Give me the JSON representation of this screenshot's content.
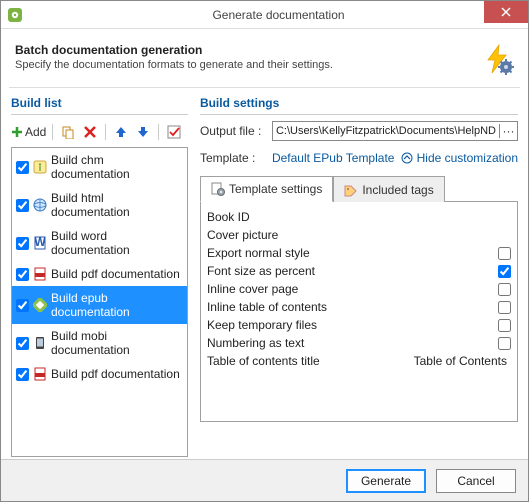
{
  "window": {
    "title": "Generate documentation",
    "close": "×"
  },
  "header": {
    "title": "Batch documentation generation",
    "subtitle": "Specify the documentation formats to generate and their settings."
  },
  "build_list": {
    "title": "Build list",
    "add_label": "Add",
    "items": [
      {
        "label": "Build chm documentation"
      },
      {
        "label": "Build html documentation"
      },
      {
        "label": "Build word documentation"
      },
      {
        "label": "Build pdf documentation"
      },
      {
        "label": "Build epub documentation"
      },
      {
        "label": "Build mobi documentation"
      },
      {
        "label": "Build pdf documentation"
      }
    ]
  },
  "build_settings": {
    "title": "Build settings",
    "output_label": "Output file :",
    "output_value": "C:\\Users\\KellyFitzpatrick\\Documents\\HelpND",
    "output_more": "···",
    "template_label": "Template :",
    "template_value": "Default EPub Template",
    "hide_customization": "Hide customization",
    "tabs": {
      "template_settings": "Template settings",
      "included_tags": "Included tags"
    },
    "settings": [
      {
        "label": "Book ID",
        "type": "text",
        "value": ""
      },
      {
        "label": "Cover picture",
        "type": "text",
        "value": ""
      },
      {
        "label": "Export normal style",
        "type": "check",
        "checked": false
      },
      {
        "label": "Font size as percent",
        "type": "check",
        "checked": true
      },
      {
        "label": "Inline cover page",
        "type": "check",
        "checked": false
      },
      {
        "label": "Inline table of contents",
        "type": "check",
        "checked": false
      },
      {
        "label": "Keep temporary files",
        "type": "check",
        "checked": false
      },
      {
        "label": "Numbering as text",
        "type": "check",
        "checked": false
      },
      {
        "label": "Table of contents title",
        "type": "text",
        "value": "Table of Contents"
      }
    ]
  },
  "footer": {
    "generate": "Generate",
    "cancel": "Cancel"
  }
}
